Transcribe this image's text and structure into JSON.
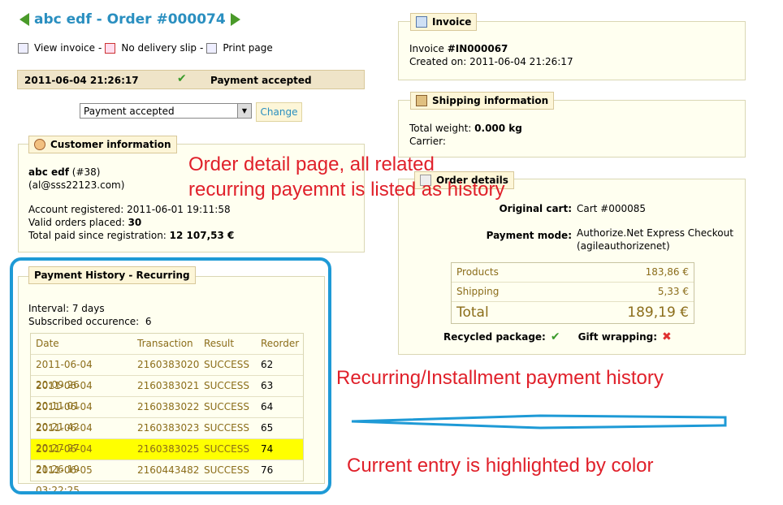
{
  "header": {
    "title": "abc edf - Order #000074"
  },
  "links": {
    "view_invoice": "View invoice",
    "sep1": "-",
    "no_delivery": "No delivery slip",
    "sep2": "-",
    "print": "Print page"
  },
  "status": {
    "date": "2011-06-04 21:26:17",
    "label": "Payment accepted"
  },
  "state_select": {
    "value": "Payment accepted",
    "button": "Change"
  },
  "customer": {
    "legend": "Customer information",
    "name": "abc edf",
    "id": "(#38)",
    "email": "(al@sss22123.com)",
    "registered_label": "Account registered:",
    "registered": "2011-06-01 19:11:58",
    "valid_label": "Valid orders placed:",
    "valid": "30",
    "paid_label": "Total paid since registration:",
    "paid": "12 107,53 €"
  },
  "payment_history": {
    "legend": "Payment History - Recurring",
    "interval_label": "Interval:",
    "interval": "7 days",
    "subscribed_label": "Subscribed occurence:",
    "subscribed": "6",
    "columns": [
      "Date",
      "Transaction",
      "Result",
      "Reorder"
    ],
    "rows": [
      {
        "date": "2011-06-04 20:09:26",
        "tx": "2160383020",
        "result": "SUCCESS",
        "reorder": "62"
      },
      {
        "date": "2011-06-04 20:11:01",
        "tx": "2160383021",
        "result": "SUCCESS",
        "reorder": "63"
      },
      {
        "date": "2011-06-04 20:21:42",
        "tx": "2160383022",
        "result": "SUCCESS",
        "reorder": "64"
      },
      {
        "date": "2011-06-04 20:27:27",
        "tx": "2160383023",
        "result": "SUCCESS",
        "reorder": "65"
      },
      {
        "date": "2011-06-04 21:26:19",
        "tx": "2160383025",
        "result": "SUCCESS",
        "reorder": "74"
      },
      {
        "date": "2011-06-05 03:22:25",
        "tx": "2160443482",
        "result": "SUCCESS",
        "reorder": "76"
      }
    ],
    "highlight_color": "#ffff00"
  },
  "invoice": {
    "legend": "Invoice",
    "number_label": "Invoice",
    "number": "#IN000067",
    "created_label": "Created on:",
    "created": "2011-06-04 21:26:17"
  },
  "shipping": {
    "legend": "Shipping information",
    "weight_label": "Total weight:",
    "weight": "0.000 kg",
    "carrier_label": "Carrier:"
  },
  "order_details": {
    "legend": "Order details",
    "cart_label": "Original cart:",
    "cart": "Cart #000085",
    "mode_label": "Payment mode:",
    "mode_line1": "Authorize.Net Express Checkout",
    "mode_line2": "(agileauthorizenet)",
    "products_label": "Products",
    "products": "183,86 €",
    "shipping_label": "Shipping",
    "shipping": "5,33 €",
    "total_label": "Total",
    "total": "189,19 €",
    "recycled_label": "Recycled package:",
    "gift_label": "Gift wrapping:"
  },
  "annotations": {
    "a1_line1": "Order detail page, all related",
    "a1_line2": "recurring payemnt is listed as history",
    "a2": "Recurring/Installment payment history",
    "a3": "Current entry is highlighted by color"
  },
  "colors": {
    "accent": "#2a8fc0",
    "annotation": "#e0202a",
    "outline": "#1e9ad6"
  }
}
